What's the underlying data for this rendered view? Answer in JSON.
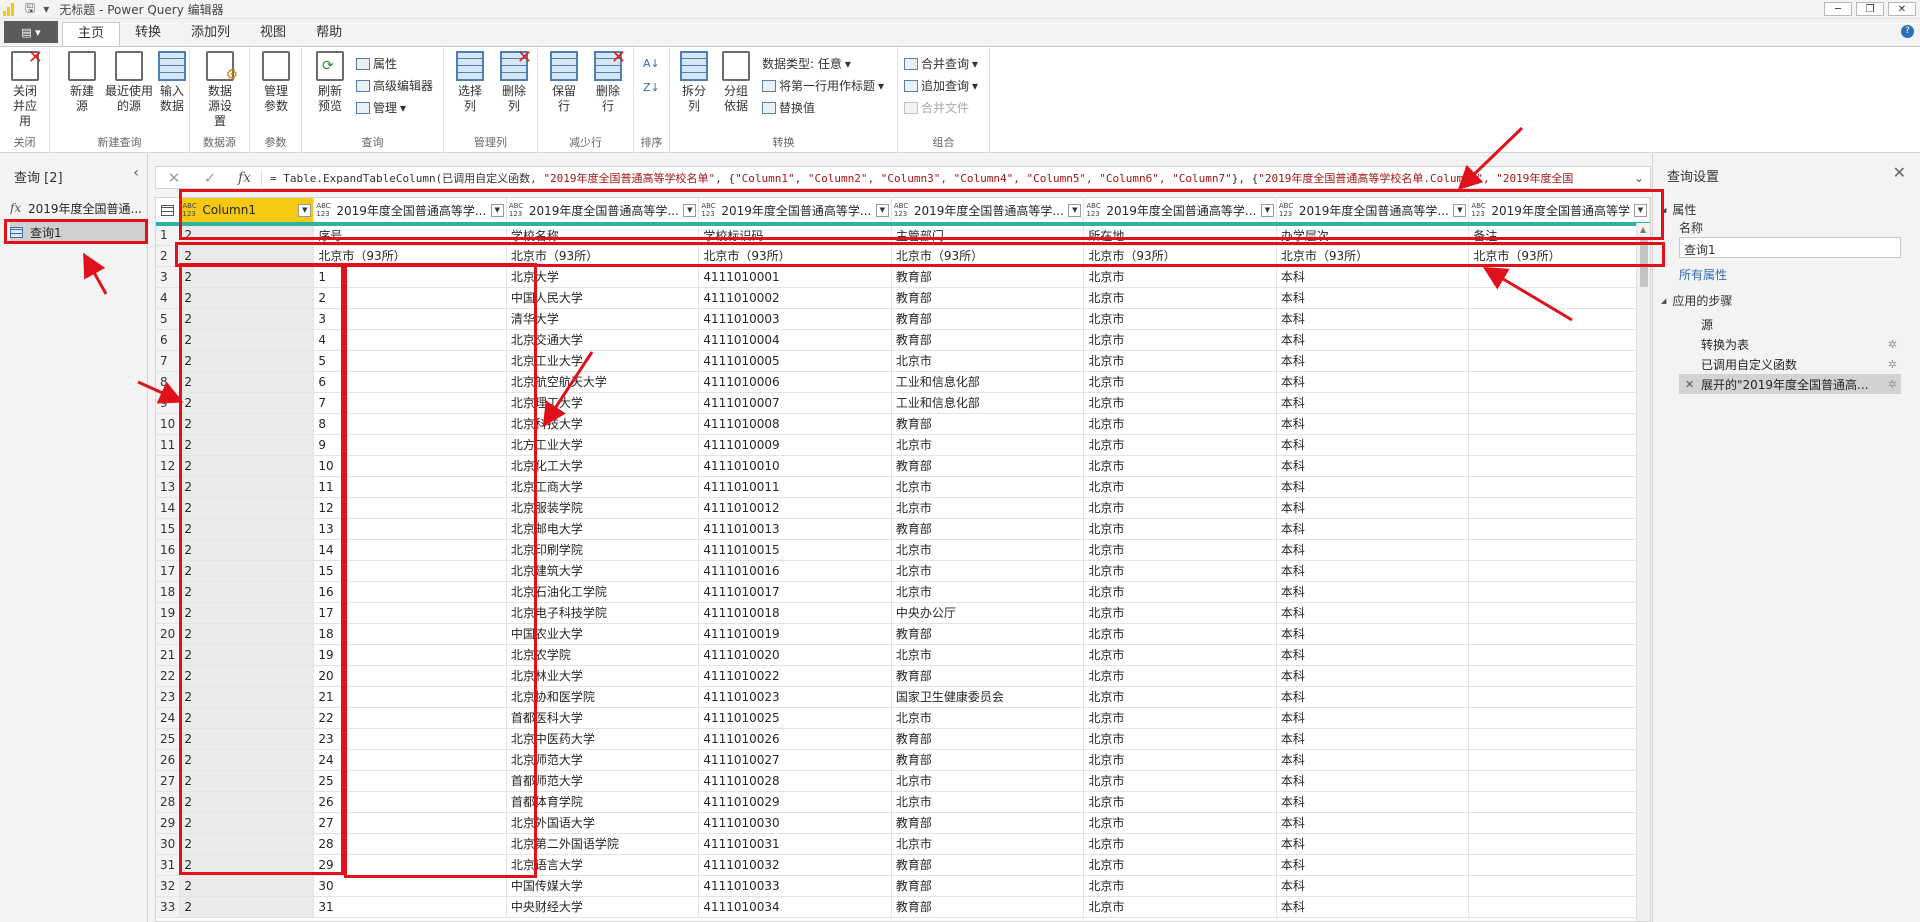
{
  "window": {
    "title": "无标题 - Power Query 编辑器",
    "controls": [
      "─",
      "❐",
      "✕"
    ]
  },
  "tabs": [
    {
      "label": "主页",
      "active": true
    },
    {
      "label": "转换"
    },
    {
      "label": "添加列"
    },
    {
      "label": "视图"
    },
    {
      "label": "帮助"
    }
  ],
  "ribbon": {
    "groups": [
      "关闭",
      "新建查询",
      "数据源",
      "参数",
      "查询",
      "管理列",
      "减少行",
      "排序",
      "转换",
      "组合"
    ],
    "close_apply": "关闭并应用",
    "new_source": "新建源",
    "recent_sources": "最近使用的源",
    "enter_data": "输入数据",
    "data_source_settings": "数据源设置",
    "manage_params": "管理参数",
    "refresh_preview": "刷新预览",
    "properties": "属性",
    "advanced_editor": "高级编辑器",
    "manage": "管理",
    "choose_cols": "选择列",
    "remove_cols": "删除列",
    "keep_rows": "保留行",
    "remove_rows": "删除行",
    "split_col": "拆分列",
    "group_by": "分组依据",
    "data_type": "数据类型: 任意",
    "first_row_header": "将第一行用作标题",
    "replace_values": "替换值",
    "merge_queries": "合并查询",
    "append_queries": "追加查询",
    "combine_files": "合并文件"
  },
  "query_pane": {
    "title": "查询 [2]",
    "items": [
      {
        "label": "2019年度全国普通...",
        "type": "fx"
      },
      {
        "label": "查询1",
        "type": "table"
      }
    ]
  },
  "formula": {
    "prefix": "= Table.ExpandTableColumn(已调用自定义函数, ",
    "s1": "\"2019年度全国普通高等学校名单\"",
    "mid": ", {",
    "s2": "\"Column1\", \"Column2\", \"Column3\", \"Column4\", \"Column5\", \"Column6\", \"Column7\"",
    "mid2": "}, {",
    "s3": "\"2019年度全国普通高等学校名单.Column1\", \"2019年度全国"
  },
  "grid": {
    "type_icon": "ABC\n123",
    "headers": [
      "Column1",
      "2019年度全国普通高等学...",
      "2019年度全国普通高等学...",
      "2019年度全国普通高等学...",
      "2019年度全国普通高等学...",
      "2019年度全国普通高等学...",
      "2019年度全国普通高等学...",
      "2019年度全国普通高等学"
    ],
    "rows": [
      [
        "2",
        "序号",
        "学校名称",
        "学校标识码",
        "主管部门",
        "所在地",
        "办学层次",
        "备注"
      ],
      [
        "2",
        "北京市（93所）",
        "北京市（93所）",
        "北京市（93所）",
        "北京市（93所）",
        "北京市（93所）",
        "北京市（93所）",
        "北京市（93所）"
      ],
      [
        "2",
        "1",
        "北京大学",
        "4111010001",
        "教育部",
        "北京市",
        "本科",
        ""
      ],
      [
        "2",
        "2",
        "中国人民大学",
        "4111010002",
        "教育部",
        "北京市",
        "本科",
        ""
      ],
      [
        "2",
        "3",
        "清华大学",
        "4111010003",
        "教育部",
        "北京市",
        "本科",
        ""
      ],
      [
        "2",
        "4",
        "北京交通大学",
        "4111010004",
        "教育部",
        "北京市",
        "本科",
        ""
      ],
      [
        "2",
        "5",
        "北京工业大学",
        "4111010005",
        "北京市",
        "北京市",
        "本科",
        ""
      ],
      [
        "2",
        "6",
        "北京航空航天大学",
        "4111010006",
        "工业和信息化部",
        "北京市",
        "本科",
        ""
      ],
      [
        "2",
        "7",
        "北京理工大学",
        "4111010007",
        "工业和信息化部",
        "北京市",
        "本科",
        ""
      ],
      [
        "2",
        "8",
        "北京科技大学",
        "4111010008",
        "教育部",
        "北京市",
        "本科",
        ""
      ],
      [
        "2",
        "9",
        "北方工业大学",
        "4111010009",
        "北京市",
        "北京市",
        "本科",
        ""
      ],
      [
        "2",
        "10",
        "北京化工大学",
        "4111010010",
        "教育部",
        "北京市",
        "本科",
        ""
      ],
      [
        "2",
        "11",
        "北京工商大学",
        "4111010011",
        "北京市",
        "北京市",
        "本科",
        ""
      ],
      [
        "2",
        "12",
        "北京服装学院",
        "4111010012",
        "北京市",
        "北京市",
        "本科",
        ""
      ],
      [
        "2",
        "13",
        "北京邮电大学",
        "4111010013",
        "教育部",
        "北京市",
        "本科",
        ""
      ],
      [
        "2",
        "14",
        "北京印刷学院",
        "4111010015",
        "北京市",
        "北京市",
        "本科",
        ""
      ],
      [
        "2",
        "15",
        "北京建筑大学",
        "4111010016",
        "北京市",
        "北京市",
        "本科",
        ""
      ],
      [
        "2",
        "16",
        "北京石油化工学院",
        "4111010017",
        "北京市",
        "北京市",
        "本科",
        ""
      ],
      [
        "2",
        "17",
        "北京电子科技学院",
        "4111010018",
        "中央办公厅",
        "北京市",
        "本科",
        ""
      ],
      [
        "2",
        "18",
        "中国农业大学",
        "4111010019",
        "教育部",
        "北京市",
        "本科",
        ""
      ],
      [
        "2",
        "19",
        "北京农学院",
        "4111010020",
        "北京市",
        "北京市",
        "本科",
        ""
      ],
      [
        "2",
        "20",
        "北京林业大学",
        "4111010022",
        "教育部",
        "北京市",
        "本科",
        ""
      ],
      [
        "2",
        "21",
        "北京协和医学院",
        "4111010023",
        "国家卫生健康委员会",
        "北京市",
        "本科",
        ""
      ],
      [
        "2",
        "22",
        "首都医科大学",
        "4111010025",
        "北京市",
        "北京市",
        "本科",
        ""
      ],
      [
        "2",
        "23",
        "北京中医药大学",
        "4111010026",
        "教育部",
        "北京市",
        "本科",
        ""
      ],
      [
        "2",
        "24",
        "北京师范大学",
        "4111010027",
        "教育部",
        "北京市",
        "本科",
        ""
      ],
      [
        "2",
        "25",
        "首都师范大学",
        "4111010028",
        "北京市",
        "北京市",
        "本科",
        ""
      ],
      [
        "2",
        "26",
        "首都体育学院",
        "4111010029",
        "北京市",
        "北京市",
        "本科",
        ""
      ],
      [
        "2",
        "27",
        "北京外国语大学",
        "4111010030",
        "教育部",
        "北京市",
        "本科",
        ""
      ],
      [
        "2",
        "28",
        "北京第二外国语学院",
        "4111010031",
        "北京市",
        "北京市",
        "本科",
        ""
      ],
      [
        "2",
        "29",
        "北京语言大学",
        "4111010032",
        "教育部",
        "北京市",
        "本科",
        ""
      ],
      [
        "2",
        "30",
        "中国传媒大学",
        "4111010033",
        "教育部",
        "北京市",
        "本科",
        ""
      ],
      [
        "2",
        "31",
        "中央财经大学",
        "4111010034",
        "教育部",
        "北京市",
        "本科",
        ""
      ]
    ]
  },
  "settings": {
    "title": "查询设置",
    "properties_header": "属性",
    "name_label": "名称",
    "name_value": "查询1",
    "all_properties": "所有属性",
    "steps_header": "应用的步骤",
    "steps": [
      "源",
      "转换为表",
      "已调用自定义函数",
      "展开的\"2019年度全国普通高..."
    ]
  },
  "colors": {
    "accent_yellow": "#f5c811",
    "annotation_red": "#e0111b",
    "header_underline": "#2db3a6"
  }
}
